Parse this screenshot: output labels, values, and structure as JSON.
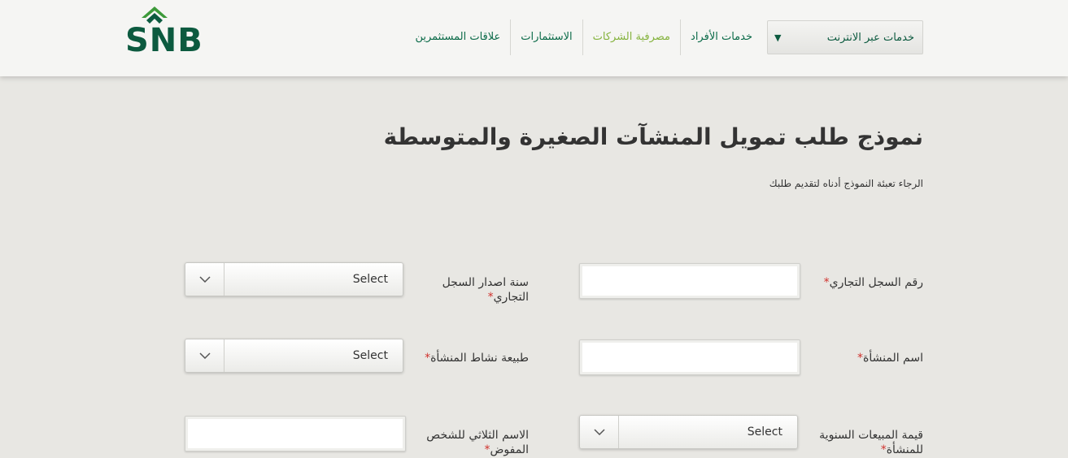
{
  "brand": {
    "logo_text": "SNB",
    "color": "#0c5a3f",
    "accent": "#85b33e",
    "required_color": "#d0322d"
  },
  "nav": {
    "online_services": "خدمات عبر الانترنت",
    "online_arrow": "▼",
    "items": [
      {
        "label": "خدمات الأفراد"
      },
      {
        "label": "مصرفية الشركات"
      },
      {
        "label": "الاستثمارات"
      },
      {
        "label": "علاقات المستثمرين"
      }
    ]
  },
  "page": {
    "title": "نموذج طلب تمويل المنشآت الصغيرة والمتوسطة",
    "subtitle": "الرجاء تعبئة النموذج أدناه لتقديم طلبك"
  },
  "form": {
    "required_mark": "*",
    "commercial_reg_number": {
      "label": "رقم السجل التجاري",
      "value": ""
    },
    "reg_year": {
      "label": "سنة اصدار السجل التجاري",
      "value": "Select"
    },
    "establishment_name": {
      "label": "اسم المنشأة",
      "value": ""
    },
    "activity_type": {
      "label": "طبيعة نشاط المنشأة",
      "value": "Select"
    },
    "annual_sales": {
      "label": "قيمة المبيعات السنوية للمنشأة",
      "value": "Select"
    },
    "authorized_name": {
      "label": "الاسم الثلاثي للشخص المفوض",
      "value": ""
    }
  }
}
